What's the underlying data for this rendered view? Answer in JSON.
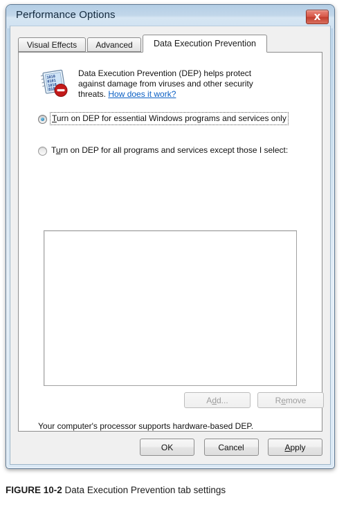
{
  "window": {
    "title": "Performance Options",
    "close_label": "Close"
  },
  "tabs": [
    {
      "label": "Visual Effects",
      "active": false
    },
    {
      "label": "Advanced",
      "active": false
    },
    {
      "label": "Data Execution Prevention",
      "active": true
    }
  ],
  "dep": {
    "icon_name": "dep-shield-icon",
    "description_line1": "Data Execution Prevention (DEP) helps protect",
    "description_line2": "against damage from viruses and other security",
    "description_line3_prefix": "threats. ",
    "link_text": "How does it work?",
    "options": [
      {
        "accel": "T",
        "text_before": "",
        "text_after": "urn on DEP for essential Windows programs and services only",
        "selected": true,
        "focused": true
      },
      {
        "accel": "u",
        "text_before": "T",
        "text_after": "rn on DEP for all programs and services except those I select:",
        "selected": false,
        "focused": false
      }
    ],
    "list_items": [],
    "add_button": {
      "before": "A",
      "accel": "d",
      "after": "d...",
      "disabled": true
    },
    "remove_button": {
      "before": "R",
      "accel": "e",
      "after": "move",
      "disabled": true
    },
    "status_text": "Your computer's processor supports hardware-based DEP."
  },
  "footer": {
    "ok": {
      "label": "OK"
    },
    "cancel": {
      "label": "Cancel"
    },
    "apply": {
      "accel": "A",
      "after": "pply"
    }
  },
  "caption": {
    "figure_label": "FIGURE 10-2",
    "text": "Data Execution Prevention tab settings"
  },
  "colors": {
    "title_bar": "#c2d7ea",
    "close_button": "#d8594a",
    "link": "#0a5fc4",
    "radio_dot": "#1474a8",
    "dialog_bg": "#f0f0f0",
    "panel_bg": "#ffffff"
  }
}
